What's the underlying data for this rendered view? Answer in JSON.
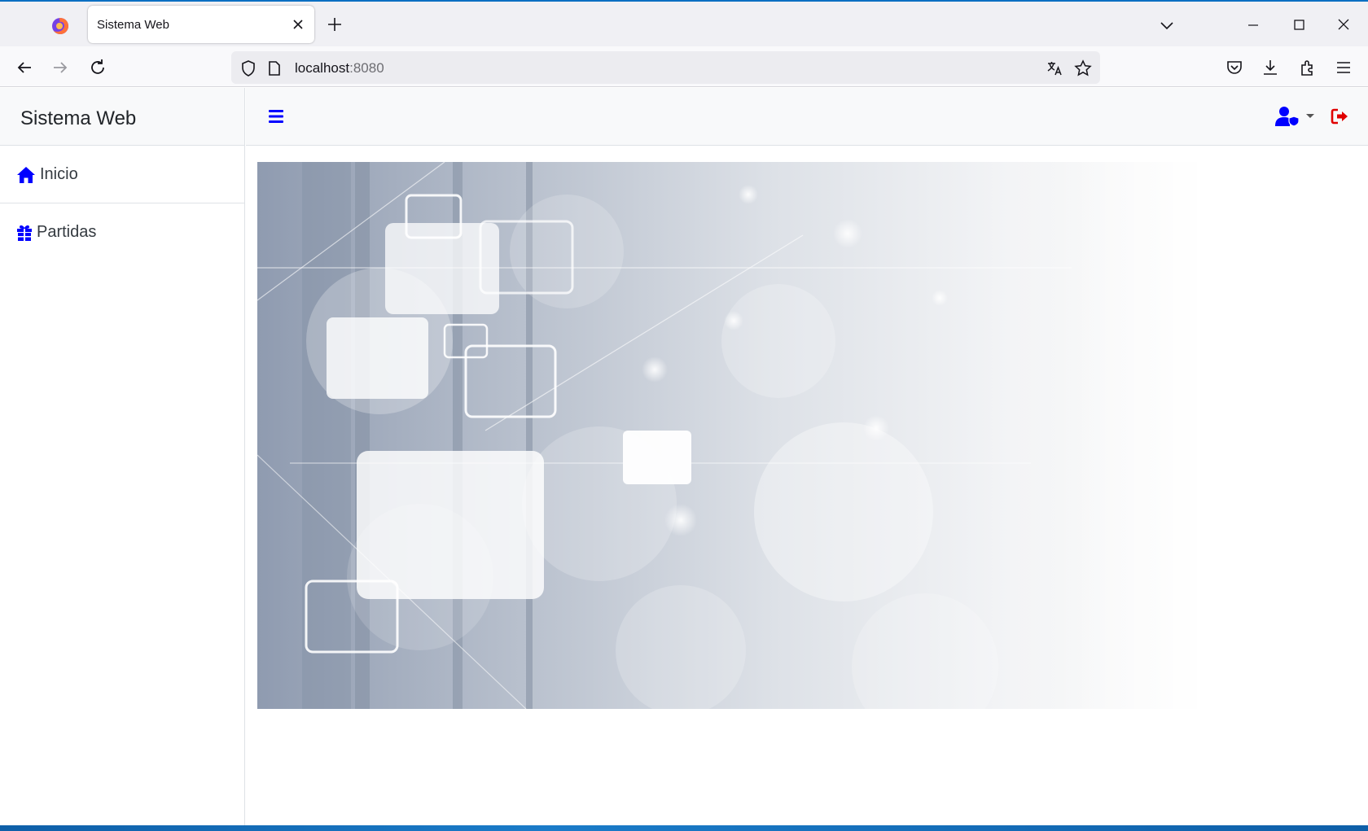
{
  "browser": {
    "tab_title": "Sistema Web",
    "url_host": "localhost",
    "url_port": ":8080",
    "accent": "#0a6fc2"
  },
  "sidebar": {
    "brand": "Sistema Web",
    "items": [
      {
        "label": "Inicio",
        "icon": "home-icon"
      },
      {
        "label": "Partidas",
        "icon": "gift-icon"
      }
    ]
  },
  "topnav": {
    "menu_icon": "hamburger-icon",
    "user_icon": "user-shield-icon",
    "logout_icon": "sign-out-icon",
    "icon_color": "#0000ff",
    "logout_color": "#e00000"
  }
}
